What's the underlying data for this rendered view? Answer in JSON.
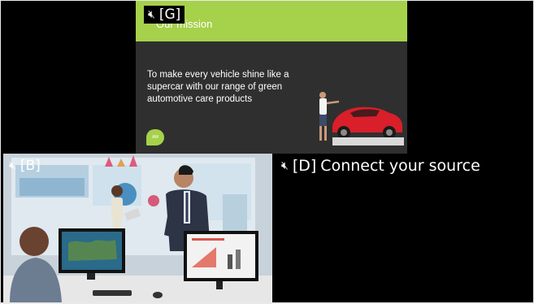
{
  "tiles": {
    "g": {
      "label": "[G]",
      "icon": "speaker-muted-icon",
      "slide": {
        "title": "Our mission",
        "body": "To make every vehicle shine like a supercar with our range of green automotive care products",
        "brand": "AW",
        "accent": "#a6d14b"
      }
    },
    "b": {
      "label": "[B]",
      "icon": "speaker-muted-icon"
    },
    "d": {
      "label": "[D]",
      "text": "Connect your source",
      "icon": "speaker-muted-icon"
    }
  }
}
